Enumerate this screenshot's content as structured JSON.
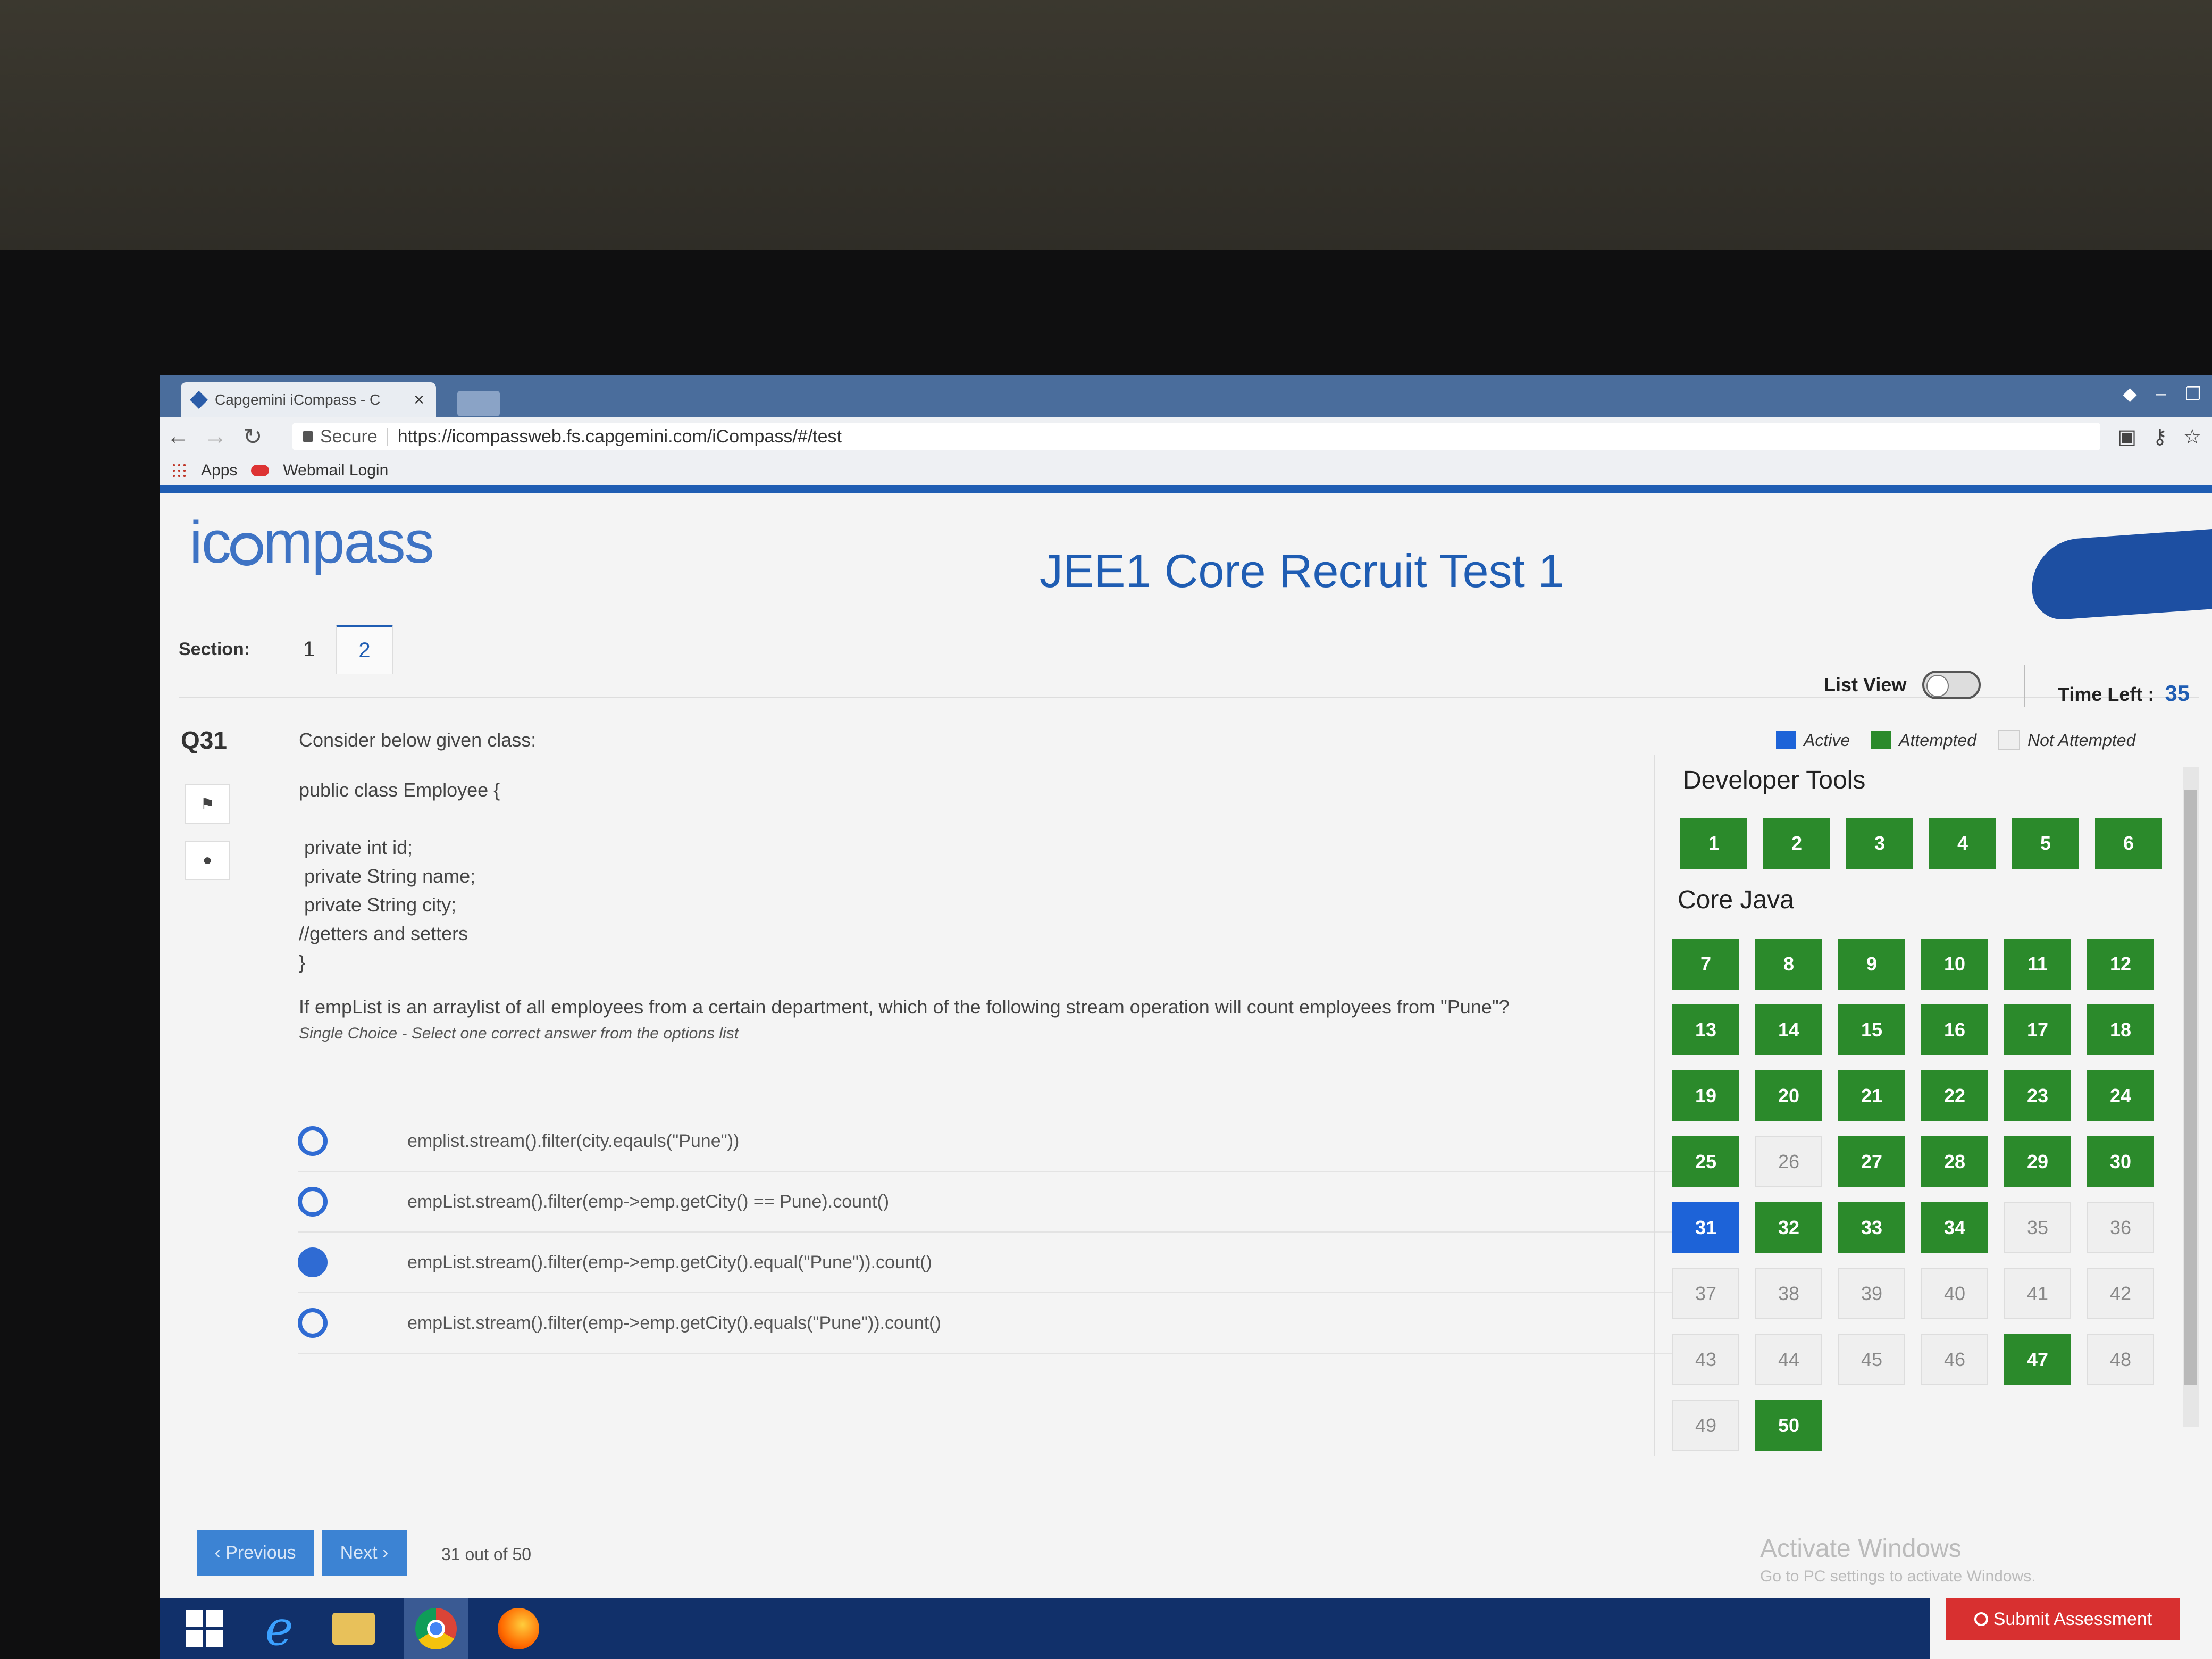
{
  "browser": {
    "tab_title": "Capgemini iCompass - C",
    "tab_close": "×",
    "secure_label": "Secure",
    "url": "https://icompassweb.fs.capgemini.com/iCompass/#/test",
    "bookmarks": [
      "Apps",
      "Webmail Login"
    ]
  },
  "app": {
    "logo_left": "ic",
    "logo_right": "mpass",
    "test_title": "JEE1 Core Recruit Test 1"
  },
  "sections": {
    "label": "Section:",
    "tabs": [
      "1",
      "2"
    ],
    "active": "2"
  },
  "controls": {
    "list_view_label": "List View",
    "time_left_label": "Time Left :",
    "time_left_value": "35"
  },
  "question": {
    "number": "Q31",
    "intro": "Consider below given class:",
    "code": "public class Employee {\n\n private int id;\n private String name;\n private String city;\n//getters and setters\n}",
    "prompt": "If empList is an arraylist of all employees from a certain department, which of the following stream operation will count employees from \"Pune\"?",
    "hint": "Single Choice - Select one correct answer from the options list",
    "options": [
      {
        "text": "emplist.stream().filter(city.eqauls(\"Pune\"))",
        "checked": false
      },
      {
        "text": "empList.stream().filter(emp->emp.getCity() == Pune).count()",
        "checked": false
      },
      {
        "text": "empList.stream().filter(emp->emp.getCity().equal(\"Pune\")).count()",
        "checked": true
      },
      {
        "text": "empList.stream().filter(emp->emp.getCity().equals(\"Pune\")).count()",
        "checked": false
      }
    ]
  },
  "legend": {
    "active": "Active",
    "attempted": "Attempted",
    "not_attempted": "Not Attempted",
    "colors": {
      "active": "#1d63d8",
      "attempted": "#2b8a2b",
      "not_attempted": "#efefef"
    }
  },
  "palette": {
    "groups": [
      {
        "title": "Developer Tools",
        "items": [
          {
            "n": "1",
            "s": "attempted"
          },
          {
            "n": "2",
            "s": "attempted"
          },
          {
            "n": "3",
            "s": "attempted"
          },
          {
            "n": "4",
            "s": "attempted"
          },
          {
            "n": "5",
            "s": "attempted"
          },
          {
            "n": "6",
            "s": "attempted"
          }
        ]
      },
      {
        "title": "Core Java",
        "items": [
          {
            "n": "7",
            "s": "attempted"
          },
          {
            "n": "8",
            "s": "attempted"
          },
          {
            "n": "9",
            "s": "attempted"
          },
          {
            "n": "10",
            "s": "attempted"
          },
          {
            "n": "11",
            "s": "attempted"
          },
          {
            "n": "12",
            "s": "attempted"
          },
          {
            "n": "13",
            "s": "attempted"
          },
          {
            "n": "14",
            "s": "attempted"
          },
          {
            "n": "15",
            "s": "attempted"
          },
          {
            "n": "16",
            "s": "attempted"
          },
          {
            "n": "17",
            "s": "attempted"
          },
          {
            "n": "18",
            "s": "attempted"
          },
          {
            "n": "19",
            "s": "attempted"
          },
          {
            "n": "20",
            "s": "attempted"
          },
          {
            "n": "21",
            "s": "attempted"
          },
          {
            "n": "22",
            "s": "attempted"
          },
          {
            "n": "23",
            "s": "attempted"
          },
          {
            "n": "24",
            "s": "attempted"
          },
          {
            "n": "25",
            "s": "attempted"
          },
          {
            "n": "26",
            "s": "not"
          },
          {
            "n": "27",
            "s": "attempted"
          },
          {
            "n": "28",
            "s": "attempted"
          },
          {
            "n": "29",
            "s": "attempted"
          },
          {
            "n": "30",
            "s": "attempted"
          },
          {
            "n": "31",
            "s": "active"
          },
          {
            "n": "32",
            "s": "attempted"
          },
          {
            "n": "33",
            "s": "attempted"
          },
          {
            "n": "34",
            "s": "attempted"
          },
          {
            "n": "35",
            "s": "not"
          },
          {
            "n": "36",
            "s": "not"
          },
          {
            "n": "37",
            "s": "not"
          },
          {
            "n": "38",
            "s": "not"
          },
          {
            "n": "39",
            "s": "not"
          },
          {
            "n": "40",
            "s": "not"
          },
          {
            "n": "41",
            "s": "not"
          },
          {
            "n": "42",
            "s": "not"
          },
          {
            "n": "43",
            "s": "not"
          },
          {
            "n": "44",
            "s": "not"
          },
          {
            "n": "45",
            "s": "not"
          },
          {
            "n": "46",
            "s": "not"
          },
          {
            "n": "47",
            "s": "attempted"
          },
          {
            "n": "48",
            "s": "not"
          },
          {
            "n": "49",
            "s": "not"
          },
          {
            "n": "50",
            "s": "attempted"
          }
        ]
      }
    ]
  },
  "footer": {
    "prev_label": "‹ Previous",
    "next_label": "Next ›",
    "counter": "31 out of 50",
    "submit_label": "Submit Assessment",
    "watermark_line1": "Activate Windows",
    "watermark_line2": "Go to PC settings to activate Windows."
  }
}
